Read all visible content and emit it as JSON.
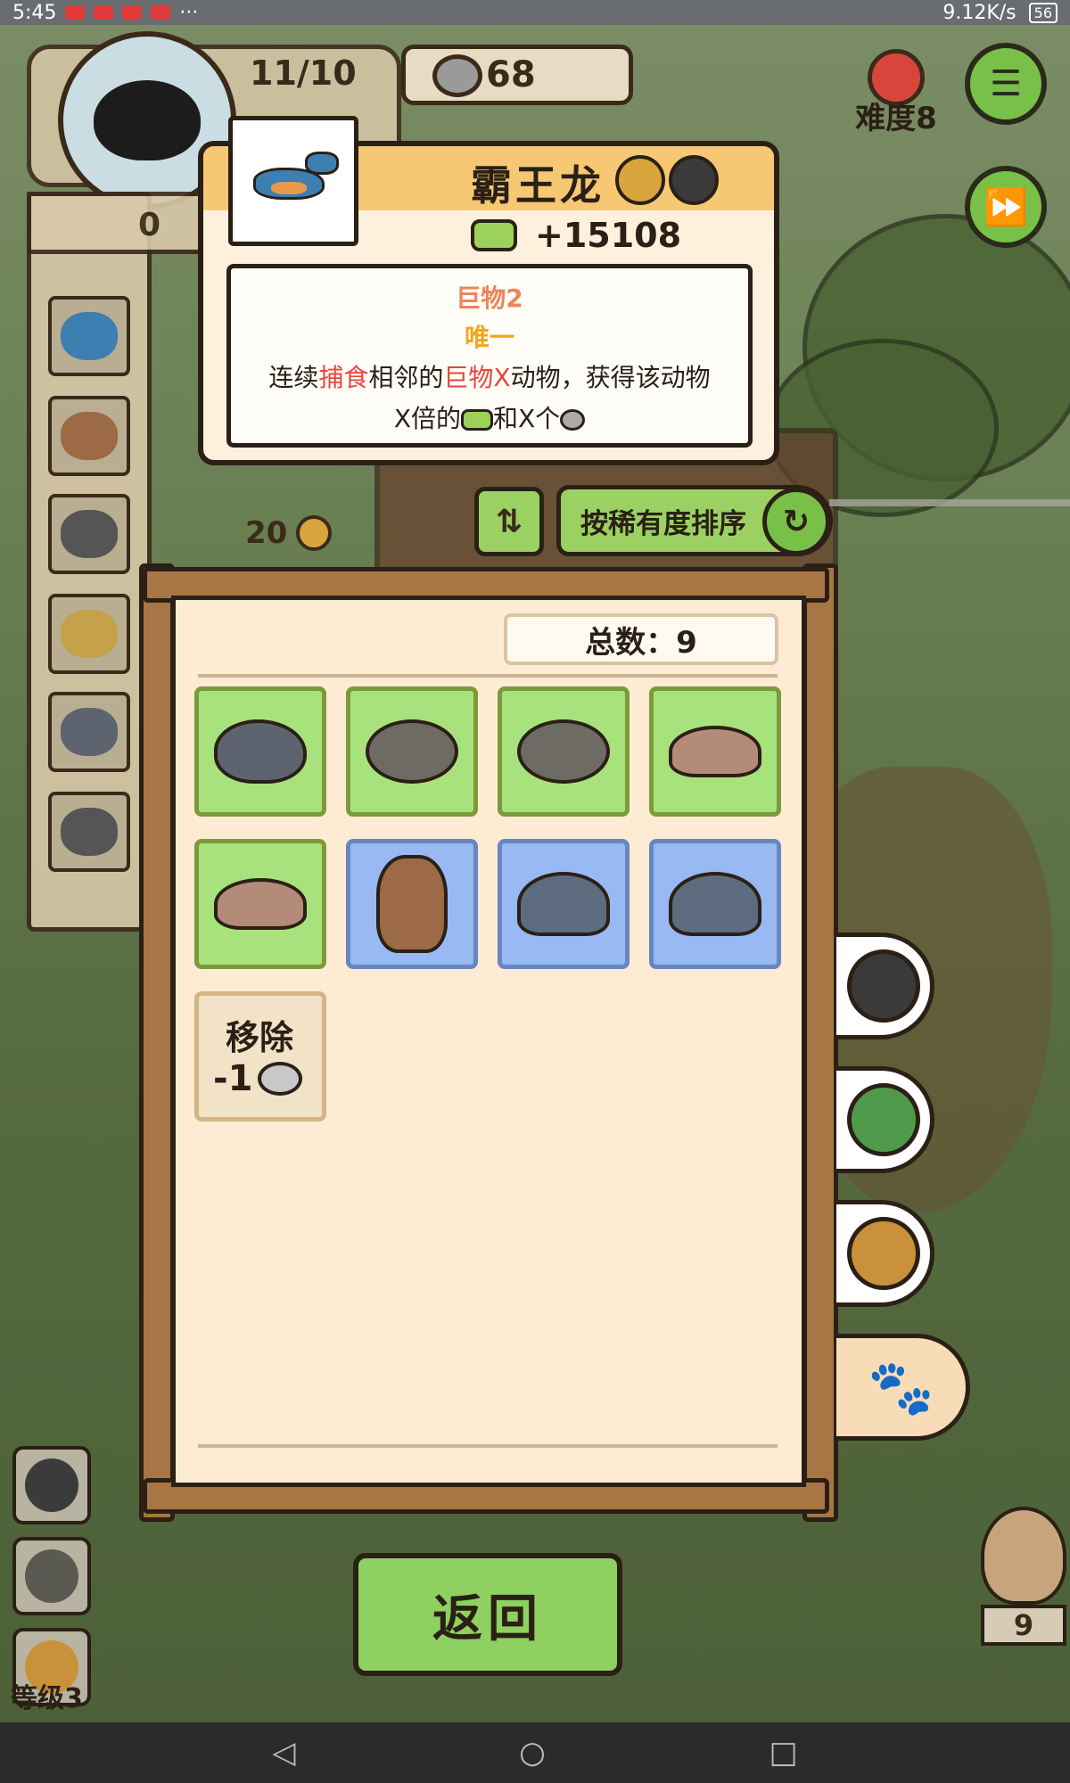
{
  "status_bar": {
    "time": "5:45",
    "notifications": "···",
    "speed": "9.12K/s",
    "battery": "56"
  },
  "hud": {
    "stage": "11/10",
    "coins": "68",
    "difficulty": "难度8",
    "left_count": "0",
    "paw_count": "20"
  },
  "tooltip": {
    "name": "霸王龙",
    "value": "+15108",
    "tag1": "巨物2",
    "tag2": "唯一",
    "desc_line1_a": "连续",
    "desc_line1_b": "捕食",
    "desc_line1_c": "相邻的",
    "desc_line1_d": "巨物X",
    "desc_line1_e": "动物，获得该动物",
    "desc_line2_a": "X倍的",
    "desc_line2_b": "和X个"
  },
  "sort": {
    "label": "按稀有度排序"
  },
  "board": {
    "total": "总数：9",
    "remove_label": "移除",
    "remove_cost": "-1"
  },
  "back_button": "返回",
  "level_label": "等级3",
  "owl_count": "9",
  "icons": {
    "tab1": "cat-face-icon",
    "tab2": "green-bird-icon",
    "tab3": "skull-icon",
    "tab4": "paw-icon"
  },
  "colors": {
    "accent_green": "#9bd162",
    "rare_blue": "#98b9f3",
    "common_green": "#a8e27c",
    "highlight_red": "#e8463c"
  }
}
